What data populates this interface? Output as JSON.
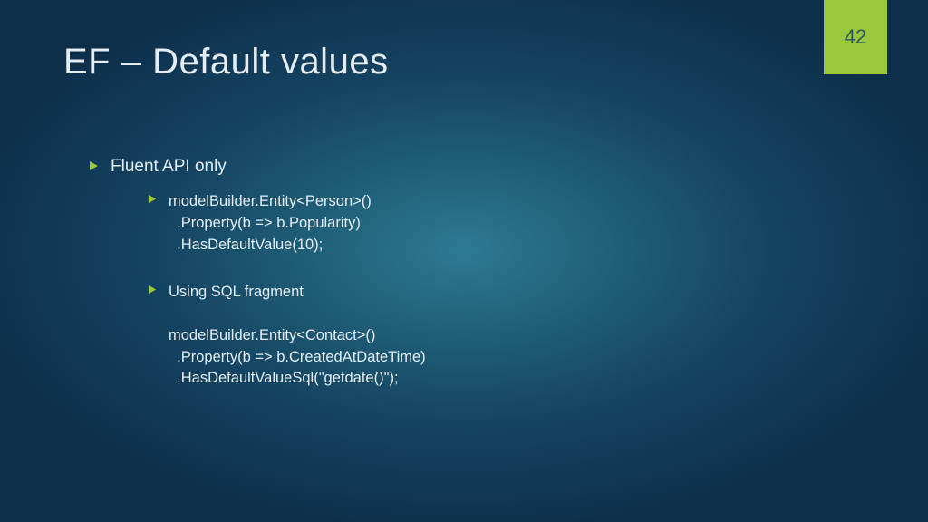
{
  "slide": {
    "title": "EF – Default values",
    "page_number": "42"
  },
  "accent_color": "#9ac83c",
  "bullets": {
    "level1": {
      "text": "Fluent API only"
    },
    "level2": [
      {
        "text": "modelBuilder.Entity<Person>()\n  .Property(b => b.Popularity)\n  .HasDefaultValue(10);"
      },
      {
        "text": "Using SQL fragment\n\nmodelBuilder.Entity<Contact>()\n  .Property(b => b.CreatedAtDateTime)\n  .HasDefaultValueSql(\"getdate()\");"
      }
    ]
  }
}
